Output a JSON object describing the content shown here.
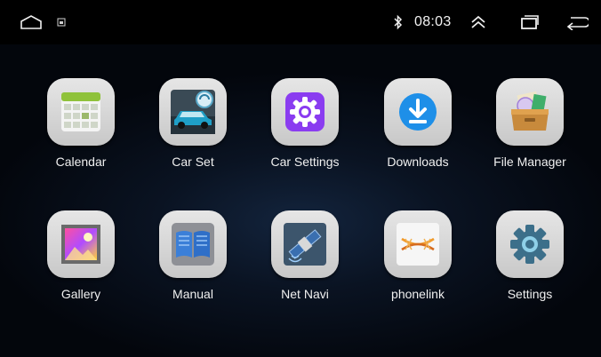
{
  "status_bar": {
    "time": "08:03",
    "icons": [
      "home-icon",
      "notification-icon",
      "bluetooth-icon",
      "expand-up-icon",
      "recent-apps-icon",
      "back-icon"
    ]
  },
  "apps": [
    {
      "label": "Calendar",
      "icon": "calendar-icon"
    },
    {
      "label": "Car Set",
      "icon": "car-set-icon"
    },
    {
      "label": "Car Settings",
      "icon": "car-settings-gear-icon"
    },
    {
      "label": "Downloads",
      "icon": "download-arrow-icon"
    },
    {
      "label": "File Manager",
      "icon": "file-box-icon"
    },
    {
      "label": "Gallery",
      "icon": "gallery-picture-icon"
    },
    {
      "label": "Manual",
      "icon": "manual-book-icon"
    },
    {
      "label": "Net Navi",
      "icon": "satellite-icon"
    },
    {
      "label": "phonelink",
      "icon": "phonelink-icon"
    },
    {
      "label": "Settings",
      "icon": "settings-gear-icon"
    }
  ],
  "colors": {
    "status_bar": "#000000",
    "background": "#0a1322",
    "tile": "#d8d8d8",
    "car_settings_accent": "#8a3cf0",
    "downloads_accent": "#1e8fe8",
    "settings_accent": "#3c6f8a"
  }
}
